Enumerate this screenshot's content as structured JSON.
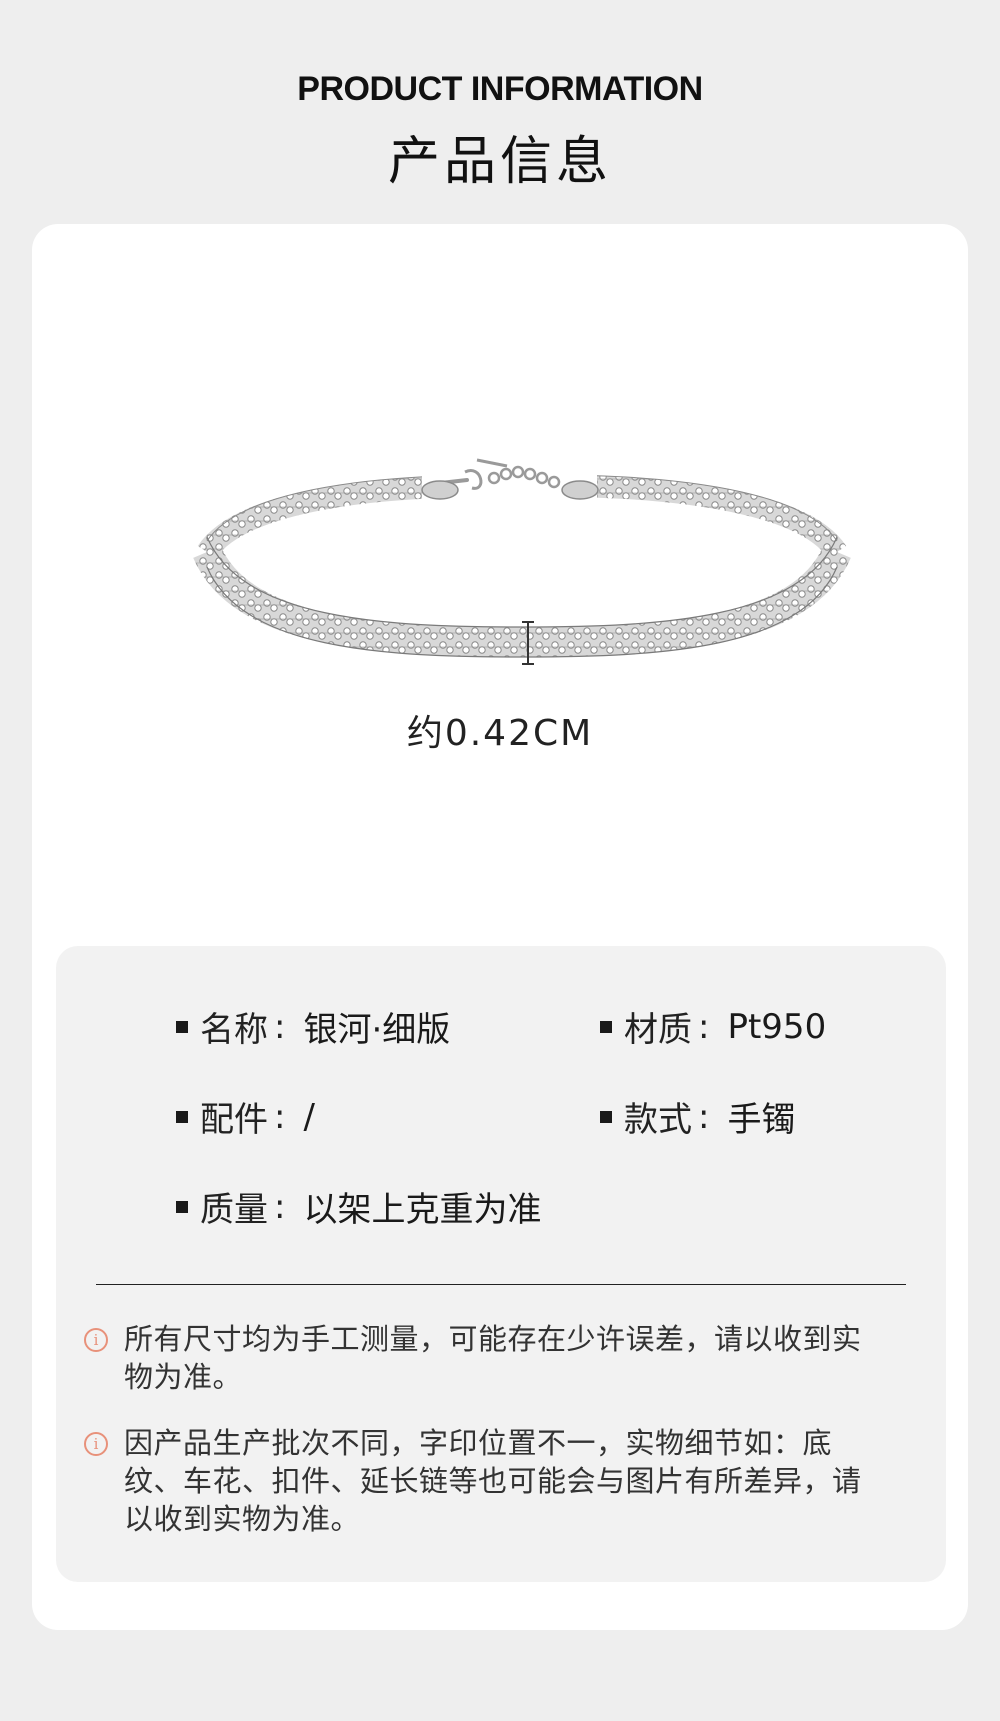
{
  "header": {
    "title_en": "PRODUCT INFORMATION",
    "title_cn": "产品信息"
  },
  "product": {
    "image_icon": "bracelet-image",
    "dimension_label": "约0.42CM"
  },
  "specs": {
    "name": {
      "key": "名称",
      "sep": ":",
      "value": "银河·细版"
    },
    "material": {
      "key": "材质",
      "sep": ":",
      "value": "Pt950"
    },
    "accessory": {
      "key": "配件",
      "sep": ":",
      "value": "/"
    },
    "style": {
      "key": "款式",
      "sep": ":",
      "value": "手镯"
    },
    "weight": {
      "key": "质量",
      "sep": ":",
      "value": "以架上克重为准"
    }
  },
  "notes": [
    {
      "icon": "info-icon",
      "text": "所有尺寸均为手工测量，可能存在少许误差，请以收到实物为准。"
    },
    {
      "icon": "info-icon",
      "text": "因产品生产批次不同，字印位置不一，实物细节如：底纹、车花、扣件、延长链等也可能会与图片有所差异，请以收到实物为准。"
    }
  ],
  "colors": {
    "background": "#eeeeee",
    "card": "#ffffff",
    "panel": "#f2f2f2",
    "note_icon": "#e8917a"
  }
}
